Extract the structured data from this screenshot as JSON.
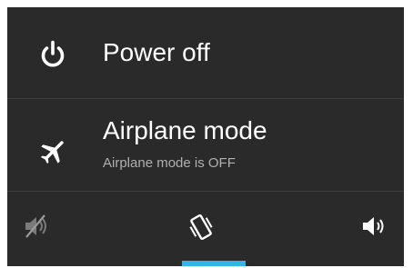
{
  "power_row": {
    "title": "Power off",
    "icon": "power-icon"
  },
  "airplane_row": {
    "title": "Airplane mode",
    "status": "Airplane mode is OFF",
    "icon": "airplane-icon"
  },
  "sound_modes": {
    "items": [
      {
        "mode": "silent",
        "icon": "sound-off-icon"
      },
      {
        "mode": "vibrate",
        "icon": "vibrate-icon"
      },
      {
        "mode": "sound on",
        "icon": "sound-on-icon"
      }
    ],
    "selected": "vibrate"
  },
  "colors": {
    "background": "#2a2a2a",
    "text": "#ffffff",
    "subtext": "#b0b0b0",
    "accent": "#33b5e5",
    "inactive_icon": "#7a7a7a"
  }
}
